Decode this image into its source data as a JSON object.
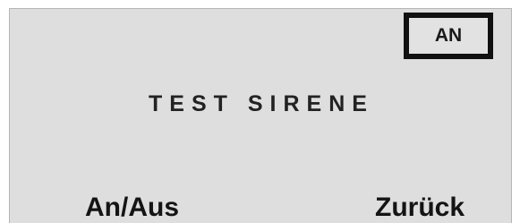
{
  "status": {
    "label": "AN"
  },
  "title": "TEST SIRENE",
  "softkeys": {
    "left": "An/Aus",
    "right": "Zurück"
  }
}
